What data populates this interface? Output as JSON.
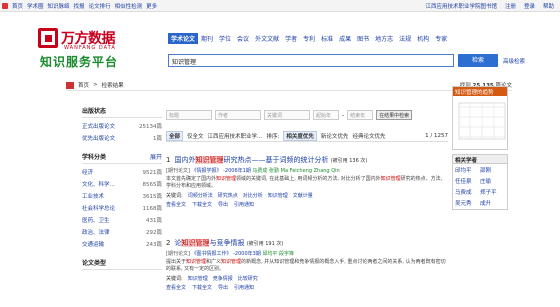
{
  "topbar": {
    "items": [
      "首页",
      "学术圈",
      "知识脉络",
      "找报",
      "论文排行",
      "相似性检测",
      "更多"
    ],
    "right": [
      "江西应用技术职业学院图书馆",
      "注册",
      "登录",
      "帮助"
    ]
  },
  "logo": {
    "cn": "万方数据",
    "en": "WANFANG DATA",
    "platform": "知识服务平台"
  },
  "nav": {
    "tabs": [
      "学术论文",
      "期刊",
      "学位",
      "会议",
      "外文文献",
      "学者",
      "专利",
      "标准",
      "成果",
      "图书",
      "地方志",
      "法规",
      "机构",
      "专家"
    ]
  },
  "search": {
    "value": "知识管理",
    "button": "检索",
    "advanced": "高级检索"
  },
  "crumb": {
    "home": "首页",
    "current": "检索结果",
    "count_label": "找到",
    "count": "25,135",
    "count_suffix": "篇论文"
  },
  "sidebar": {
    "status_title": "出版状态",
    "status": [
      {
        "label": "正式出版论文",
        "count": "25134篇"
      },
      {
        "label": "优先出版论文",
        "count": "1篇"
      }
    ],
    "subject_title": "学科分类",
    "subject_more": "展开",
    "subjects": [
      {
        "label": "经济",
        "count": "9521篇"
      },
      {
        "label": "文化、科学…",
        "count": "8565篇"
      },
      {
        "label": "工业技术",
        "count": "3615篇"
      },
      {
        "label": "社会科学总论",
        "count": "1168篇"
      },
      {
        "label": "医药、卫生",
        "count": "431篇"
      },
      {
        "label": "政治、法律",
        "count": "292篇"
      },
      {
        "label": "交通运输",
        "count": "243篇"
      }
    ],
    "type_title": "论文类型"
  },
  "filter": {
    "title_ph": "标题",
    "author_ph": "作者",
    "keyword_ph": "关键词",
    "from": "起始年",
    "to": "结束年",
    "button": "在结果中检索"
  },
  "sort": {
    "all": "全部",
    "only_full": "仅全文",
    "inst": "江西应用技术职业学…",
    "sort_label": "排序:",
    "relevance": "相关度优先",
    "newest": "新论文优先",
    "classic": "经典论文优先",
    "pages": "1 / 1257"
  },
  "results": [
    {
      "num": "1",
      "title_pre": "国内外",
      "title_hl": "知识管理",
      "title_post": "研究热点——基于词频的统计分析",
      "cited": "(被引用 136 次)",
      "meta_type": "[期刊论文]",
      "source": "《情报学报》",
      "year_issue": "-2006年1期",
      "authors": [
        "马费成",
        "张勤",
        "Ma Feicheng",
        "Zhang Qin"
      ],
      "abstract_pre": "本文首先确定了国内外",
      "abstract_k1": "知识管理",
      "abstract_mid": "领域的关键词, 在此基础上, 用词频分析的方法, 对比分析了国内外",
      "abstract_k2": "知识管理",
      "abstract_post": "研究的热点、方法、学科分布和应用领域。",
      "keywords_label": "关键词:",
      "keywords": [
        "词频分析法",
        "研究热点",
        "对比分析",
        "知识管理",
        "文献计量"
      ],
      "actions": [
        "查看全文",
        "下载全文",
        "导出",
        "引用通知"
      ]
    },
    {
      "num": "2",
      "title_pre": "论",
      "title_hl": "知识管理",
      "title_post": "与竞争情报",
      "cited": "(被引用 191 次)",
      "meta_type": "[期刊论文]",
      "source": "《图书情报工作》",
      "year_issue": "-2000年3期",
      "authors": [
        "邱均平",
        "段宇锋"
      ],
      "abstract_pre": "提出关于",
      "abstract_k1": "知识管理",
      "abstract_mid": "和广义",
      "abstract_k2": "知识管理",
      "abstract_post": "的新概念, 并从知识管理和竞争情报的概念入手, 重点讨论两者之间的关系, 认为两者既有密切的联系, 又有一定的区别。",
      "keywords_label": "关键词:",
      "keywords": [
        "知识管理",
        "竞争情报",
        "比较研究"
      ],
      "actions": [
        "查看全文",
        "下载全文",
        "导出",
        "引用通知"
      ]
    }
  ],
  "trend": {
    "title": "知识管理的趋势"
  },
  "chart_data": {
    "type": "line",
    "title": "",
    "x": [],
    "series": [],
    "xlabel": "",
    "ylabel": ""
  },
  "people": {
    "title": "相关学者",
    "names": [
      "邱均平",
      "邵刚",
      "任佳泉",
      "庄瑜",
      "马费成",
      "郑子平",
      "吴元秀",
      "成升"
    ]
  }
}
